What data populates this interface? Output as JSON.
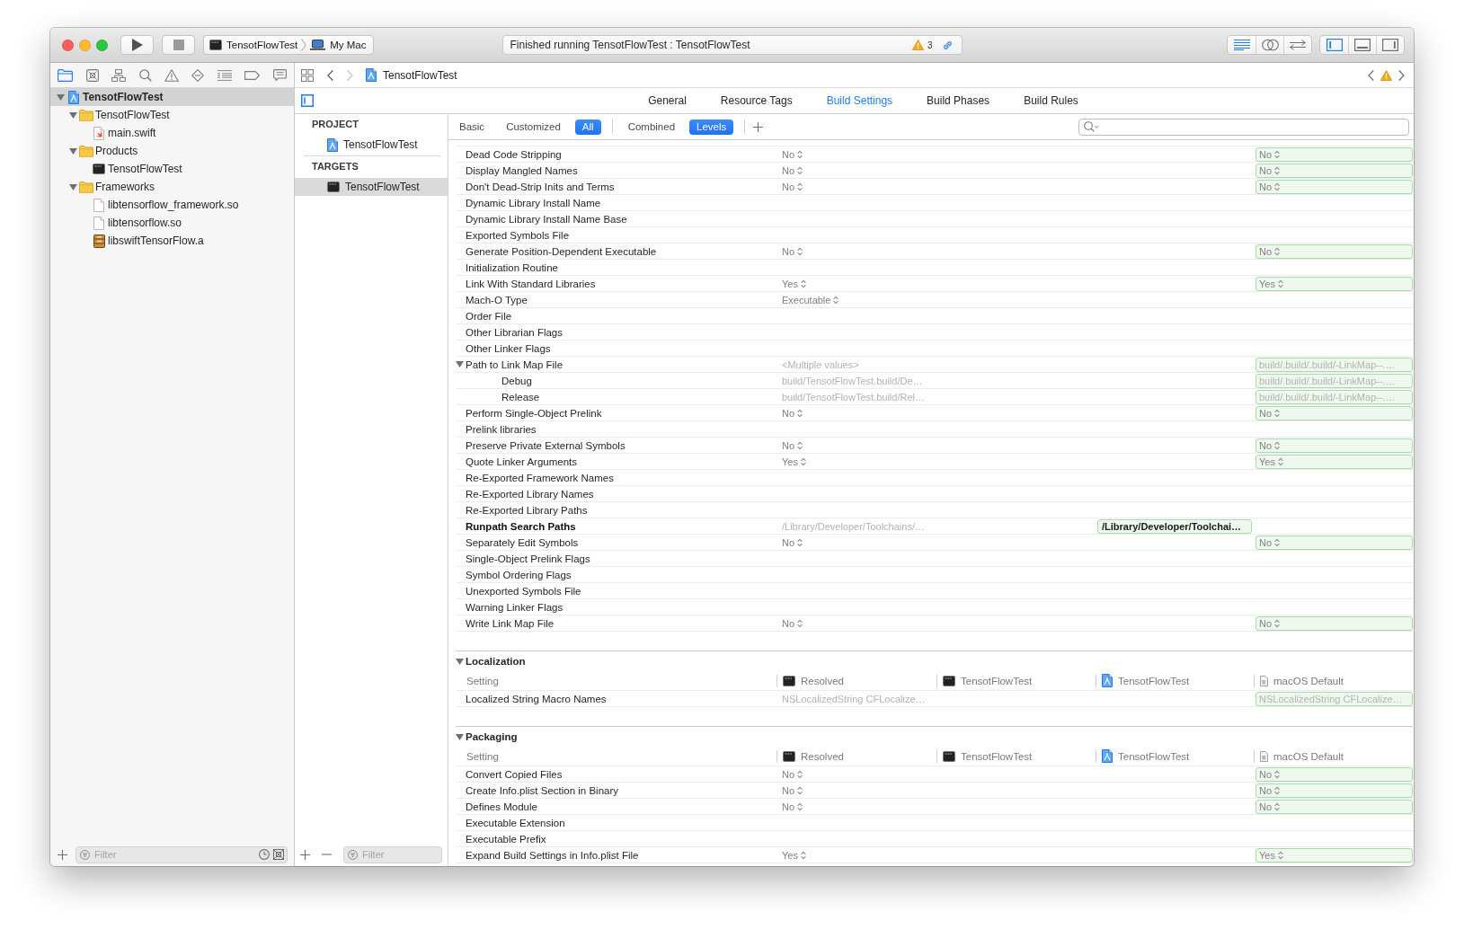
{
  "toolbar": {
    "scheme": "TensotFlowTest",
    "destination": "My Mac",
    "status": "Finished running TensotFlowTest : TensotFlowTest",
    "warning_count": "3",
    "editor_modes": [
      {
        "kind": "lines",
        "selected": true
      },
      {
        "kind": "rings",
        "selected": false
      },
      {
        "kind": "arrows",
        "selected": false
      }
    ],
    "panels": [
      {
        "kind": "left",
        "on": true
      },
      {
        "kind": "bottom",
        "on": false
      },
      {
        "kind": "right",
        "on": false
      }
    ]
  },
  "navigator": {
    "tabs": [
      {
        "kind": "folder",
        "selected": true
      },
      {
        "kind": "xbox",
        "selected": false
      },
      {
        "kind": "hierarchy",
        "selected": false
      },
      {
        "kind": "search",
        "selected": false
      },
      {
        "kind": "warning",
        "selected": false
      },
      {
        "kind": "diamond",
        "selected": false
      },
      {
        "kind": "list",
        "selected": false
      },
      {
        "kind": "tag",
        "selected": false
      },
      {
        "kind": "bubble",
        "selected": false
      }
    ],
    "tree": [
      {
        "label": "TensotFlowTest",
        "kind": "project",
        "selected": true,
        "expanded": true,
        "children": [
          {
            "label": "TensotFlowTest",
            "kind": "folder",
            "selected": false,
            "expanded": true,
            "children": [
              {
                "label": "main.swift",
                "kind": "swift",
                "selected": false
              }
            ]
          },
          {
            "label": "Products",
            "kind": "folder",
            "selected": false,
            "expanded": true,
            "children": [
              {
                "label": "TensotFlowTest",
                "kind": "terminal",
                "selected": false
              }
            ]
          },
          {
            "label": "Frameworks",
            "kind": "folder",
            "selected": false,
            "expanded": true,
            "children": [
              {
                "label": "libtensorflow_framework.so",
                "kind": "file",
                "selected": false
              },
              {
                "label": "libtensorflow.so",
                "kind": "file",
                "selected": false
              },
              {
                "label": "libswiftTensorFlow.a",
                "kind": "library",
                "selected": false
              }
            ]
          }
        ]
      }
    ],
    "filter": {
      "placeholder": "Filter"
    }
  },
  "editor": {
    "jump_bar": {
      "back": {
        "disabled": false
      },
      "forward": {
        "disabled": true
      },
      "path": [
        {
          "kind": "project",
          "label": "TensotFlowTest"
        }
      ]
    },
    "list_toggle": {
      "on": true
    },
    "tabs": [
      {
        "label": "General",
        "selected": false
      },
      {
        "label": "Resource Tags",
        "selected": false
      },
      {
        "label": "Build Settings",
        "selected": true
      },
      {
        "label": "Build Phases",
        "selected": false
      },
      {
        "label": "Build Rules",
        "selected": false
      }
    ],
    "project_list": {
      "sections": [
        {
          "title": "PROJECT",
          "items": [
            {
              "label": "TensotFlowTest",
              "kind": "project",
              "selected": false
            }
          ]
        },
        {
          "title": "TARGETS",
          "items": [
            {
              "label": "TensotFlowTest",
              "kind": "terminal",
              "selected": true
            }
          ]
        }
      ],
      "filter": {
        "placeholder": "Filter"
      }
    },
    "build_settings": {
      "scopes": [
        {
          "label": "Basic",
          "selected": false
        },
        {
          "label": "Customized",
          "selected": false
        },
        {
          "label": "All",
          "selected": true
        }
      ],
      "views": [
        {
          "label": "Combined",
          "selected": false
        },
        {
          "label": "Levels",
          "selected": true
        }
      ],
      "sections": [
        {
          "rows": [
            {
              "name": "Dead Code Stripping",
              "kind": "popup",
              "customized": false,
              "resolved": "No",
              "default": "No"
            },
            {
              "name": "Display Mangled Names",
              "kind": "popup",
              "customized": false,
              "resolved": "No",
              "default": "No"
            },
            {
              "name": "Don't Dead-Strip Inits and Terms",
              "kind": "popup",
              "customized": false,
              "resolved": "No",
              "default": "No"
            },
            {
              "name": "Dynamic Library Install Name",
              "kind": "text",
              "customized": false
            },
            {
              "name": "Dynamic Library Install Name Base",
              "kind": "text",
              "customized": false
            },
            {
              "name": "Exported Symbols File",
              "kind": "text",
              "customized": false
            },
            {
              "name": "Generate Position-Dependent Executable",
              "kind": "popup",
              "customized": false,
              "resolved": "No",
              "default": "No"
            },
            {
              "name": "Initialization Routine",
              "kind": "text",
              "customized": false
            },
            {
              "name": "Link With Standard Libraries",
              "kind": "popup",
              "customized": false,
              "resolved": "Yes",
              "default": "Yes"
            },
            {
              "name": "Mach-O Type",
              "kind": "popup",
              "customized": false,
              "resolved": "Executable"
            },
            {
              "name": "Order File",
              "kind": "text",
              "customized": false
            },
            {
              "name": "Other Librarian Flags",
              "kind": "text",
              "customized": false
            },
            {
              "name": "Other Linker Flags",
              "kind": "text",
              "customized": false
            },
            {
              "name": "Path to Link Map File",
              "kind": "text",
              "customized": false,
              "expanded": true,
              "resolved": "<Multiple values>",
              "default": "build/.build/.build/-LinkMap--.…",
              "children": [
                {
                  "name": "Debug",
                  "kind": "text",
                  "customized": false,
                  "resolved": "build/TensotFlowTest.build/De…",
                  "default": "build/.build/.build/-LinkMap--.…"
                },
                {
                  "name": "Release",
                  "kind": "text",
                  "customized": false,
                  "resolved": "build/TensotFlowTest.build/Rel…",
                  "default": "build/.build/.build/-LinkMap--.…"
                }
              ]
            },
            {
              "name": "Perform Single-Object Prelink",
              "kind": "popup",
              "customized": false,
              "resolved": "No",
              "default": "No"
            },
            {
              "name": "Prelink libraries",
              "kind": "text",
              "customized": false
            },
            {
              "name": "Preserve Private External Symbols",
              "kind": "popup",
              "customized": false,
              "resolved": "No",
              "default": "No"
            },
            {
              "name": "Quote Linker Arguments",
              "kind": "popup",
              "customized": false,
              "resolved": "Yes",
              "default": "Yes"
            },
            {
              "name": "Re-Exported Framework Names",
              "kind": "text",
              "customized": false
            },
            {
              "name": "Re-Exported Library Names",
              "kind": "text",
              "customized": false
            },
            {
              "name": "Re-Exported Library Paths",
              "kind": "text",
              "customized": false
            },
            {
              "name": "Runpath Search Paths",
              "kind": "text",
              "customized": true,
              "resolved": "/Library/Developer/Toolchains/…",
              "project": "/Library/Developer/Toolchai…"
            },
            {
              "name": "Separately Edit Symbols",
              "kind": "popup",
              "customized": false,
              "resolved": "No",
              "default": "No"
            },
            {
              "name": "Single-Object Prelink Flags",
              "kind": "text",
              "customized": false
            },
            {
              "name": "Symbol Ordering Flags",
              "kind": "text",
              "customized": false
            },
            {
              "name": "Unexported Symbols File",
              "kind": "text",
              "customized": false
            },
            {
              "name": "Warning Linker Flags",
              "kind": "text",
              "customized": false
            },
            {
              "name": "Write Link Map File",
              "kind": "popup",
              "customized": false,
              "resolved": "No",
              "default": "No"
            }
          ]
        },
        {
          "title": "Localization",
          "expanded": true,
          "columns": [
            {
              "label": "Setting",
              "kind": "setting"
            },
            {
              "label": "Resolved",
              "kind": "terminal"
            },
            {
              "label": "TensotFlowTest",
              "kind": "terminal"
            },
            {
              "label": "TensotFlowTest",
              "kind": "project"
            },
            {
              "label": "macOS Default",
              "kind": "default"
            }
          ],
          "rows": [
            {
              "name": "Localized String Macro Names",
              "kind": "text",
              "customized": false,
              "resolved": "NSLocalizedString CFLocalize…",
              "default": "NSLocalizedString CFLocalize…"
            }
          ]
        },
        {
          "title": "Packaging",
          "expanded": true,
          "columns": [
            {
              "label": "Setting",
              "kind": "setting"
            },
            {
              "label": "Resolved",
              "kind": "terminal"
            },
            {
              "label": "TensotFlowTest",
              "kind": "terminal"
            },
            {
              "label": "TensotFlowTest",
              "kind": "project"
            },
            {
              "label": "macOS Default",
              "kind": "default"
            }
          ],
          "rows": [
            {
              "name": "Convert Copied Files",
              "kind": "popup",
              "customized": false,
              "resolved": "No",
              "default": "No"
            },
            {
              "name": "Create Info.plist Section in Binary",
              "kind": "popup",
              "customized": false,
              "resolved": "No",
              "default": "No"
            },
            {
              "name": "Defines Module",
              "kind": "popup",
              "customized": false,
              "resolved": "No",
              "default": "No"
            },
            {
              "name": "Executable Extension",
              "kind": "text",
              "customized": false
            },
            {
              "name": "Executable Prefix",
              "kind": "text",
              "customized": false
            },
            {
              "name": "Expand Build Settings in Info.plist File",
              "kind": "popup",
              "customized": false,
              "resolved": "Yes",
              "default": "Yes"
            }
          ]
        }
      ]
    }
  }
}
